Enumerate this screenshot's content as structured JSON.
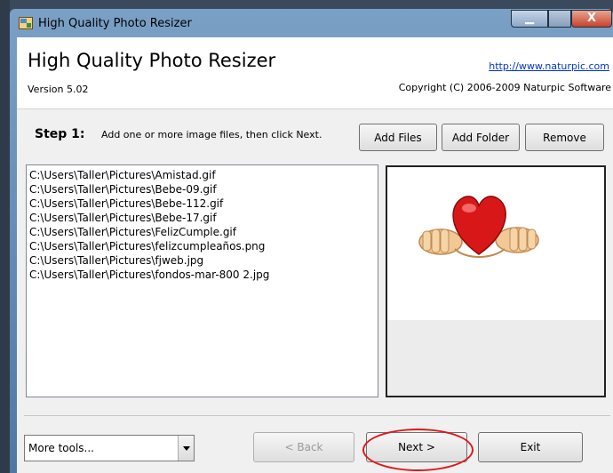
{
  "window": {
    "title": "High Quality Photo Resizer",
    "minimize_label": "▁",
    "close_label": "X"
  },
  "header": {
    "app_name": "High Quality Photo Resizer",
    "version": "Version 5.02",
    "link": "http://www.naturpic.com",
    "copyright": "Copyright (C) 2006-2009 Naturpic Software"
  },
  "step": {
    "label": "Step 1:",
    "instruction": "Add one or more image files, then click Next."
  },
  "buttons": {
    "add_files": "Add Files",
    "add_folder": "Add Folder",
    "remove": "Remove",
    "back": "< Back",
    "next": "Next >",
    "exit": "Exit"
  },
  "files": [
    "C:\\Users\\Taller\\Pictures\\Amistad.gif",
    "C:\\Users\\Taller\\Pictures\\Bebe-09.gif",
    "C:\\Users\\Taller\\Pictures\\Bebe-112.gif",
    "C:\\Users\\Taller\\Pictures\\Bebe-17.gif",
    "C:\\Users\\Taller\\Pictures\\FelizCumple.gif",
    "C:\\Users\\Taller\\Pictures\\felizcumpleaños.png",
    "C:\\Users\\Taller\\Pictures\\fjweb.jpg",
    "C:\\Users\\Taller\\Pictures\\fondos-mar-800 2.jpg"
  ],
  "more_tools": {
    "selected": "More tools..."
  },
  "colors": {
    "annotation": "#e01818",
    "heart": "#d81818",
    "link": "#0033cc"
  }
}
